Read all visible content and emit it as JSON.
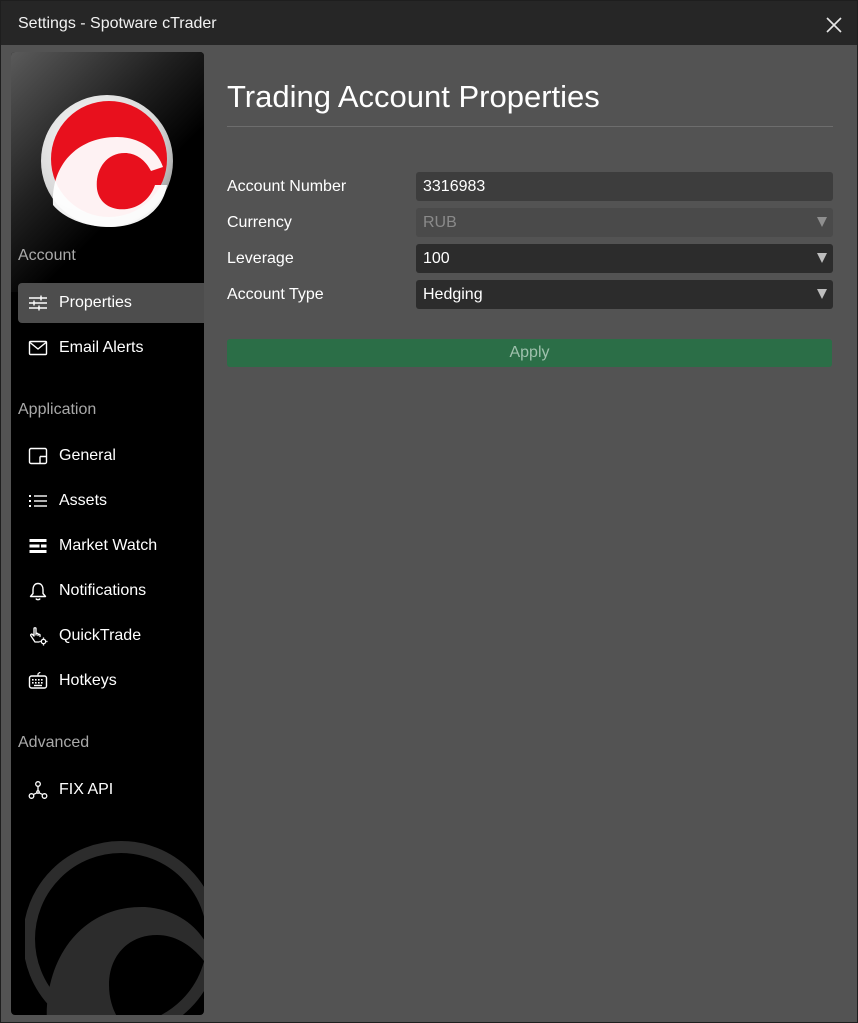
{
  "window": {
    "title": "Settings - Spotware cTrader"
  },
  "sidebar": {
    "sections": [
      {
        "label": "Account",
        "items": [
          {
            "label": "Properties",
            "icon": "sliders-icon",
            "active": true
          },
          {
            "label": "Email Alerts",
            "icon": "envelope-icon"
          }
        ]
      },
      {
        "label": "Application",
        "items": [
          {
            "label": "General",
            "icon": "panel-icon"
          },
          {
            "label": "Assets",
            "icon": "list-icon"
          },
          {
            "label": "Market Watch",
            "icon": "market-watch-icon"
          },
          {
            "label": "Notifications",
            "icon": "bell-icon"
          },
          {
            "label": "QuickTrade",
            "icon": "hand-pointer-gear-icon"
          },
          {
            "label": "Hotkeys",
            "icon": "keyboard-icon"
          }
        ]
      },
      {
        "label": "Advanced",
        "items": [
          {
            "label": "FIX API",
            "icon": "network-icon"
          }
        ]
      }
    ]
  },
  "main": {
    "heading": "Trading Account Properties",
    "fields": [
      {
        "label": "Account Number",
        "value": "3316983",
        "kind": "input"
      },
      {
        "label": "Currency",
        "value": "RUB",
        "kind": "select",
        "disabled": true
      },
      {
        "label": "Leverage",
        "value": "100",
        "kind": "select"
      },
      {
        "label": "Account Type",
        "value": "Hedging",
        "kind": "select"
      }
    ],
    "apply_label": "Apply"
  },
  "colors": {
    "accent_green": "#2b6e47",
    "logo_red": "#e8101d",
    "panel_bg": "#535353"
  }
}
